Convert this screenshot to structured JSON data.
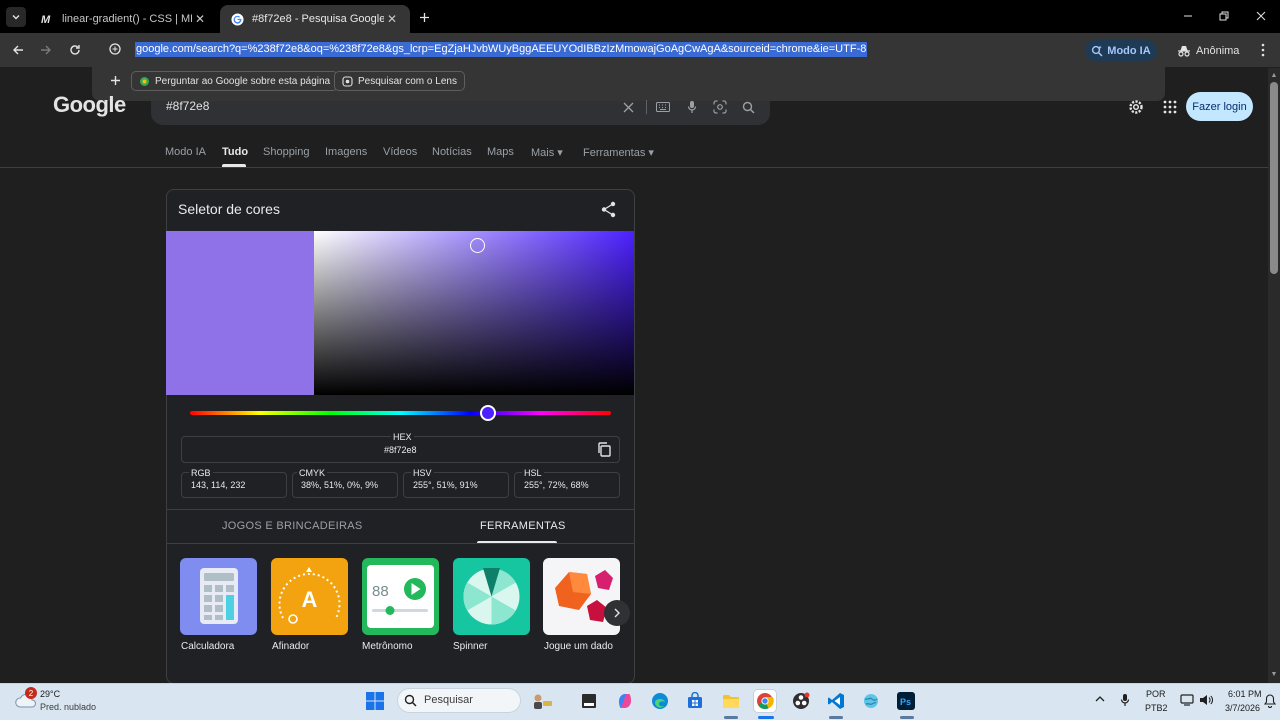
{
  "browser": {
    "tabs": [
      {
        "title": "linear-gradient() - CSS | MDN",
        "favicon": "mdn-m"
      },
      {
        "title": "#8f72e8 - Pesquisa Google",
        "favicon": "google-g",
        "active": true
      }
    ],
    "url": "google.com/search?q=%238f72e8&oq=%238f72e8&gs_lcrp=EgZjaHJvbWUyBggAEEUYOdIBBzIzMmowajGoAgCwAgA&sourceid=chrome&ie=UTF-8",
    "modo_ia_label": "Modo IA",
    "incognito_label": "Anônima",
    "dropdown_chips": [
      "Perguntar ao Google sobre esta página",
      "Pesquisar com o Lens"
    ]
  },
  "google": {
    "logo": "Google",
    "query": "#8f72e8",
    "login_label": "Fazer login",
    "nav": [
      {
        "label": "Modo IA"
      },
      {
        "label": "Tudo",
        "active": true
      },
      {
        "label": "Shopping"
      },
      {
        "label": "Imagens"
      },
      {
        "label": "Vídeos"
      },
      {
        "label": "Notícias"
      },
      {
        "label": "Maps"
      },
      {
        "label": "Mais"
      },
      {
        "label": "Ferramentas"
      }
    ]
  },
  "picker": {
    "title": "Seletor de cores",
    "selected_color": "#8f72e8",
    "hue_color": "#4c21ff",
    "hue_position": 0.708,
    "saturation": 0.51,
    "value": 0.91,
    "hex_label": "HEX",
    "hex_value": "#8f72e8",
    "fields": [
      {
        "label": "RGB",
        "value": "143, 114, 232"
      },
      {
        "label": "CMYK",
        "value": "38%, 51%, 0%, 9%"
      },
      {
        "label": "HSV",
        "value": "255°, 51%, 91%"
      },
      {
        "label": "HSL",
        "value": "255°, 72%, 68%"
      }
    ],
    "tabs": [
      {
        "label": "JOGOS E BRINCADEIRAS"
      },
      {
        "label": "FERRAMENTAS",
        "active": true
      }
    ],
    "tools": [
      {
        "label": "Calculadora",
        "icon": "calculator-icon"
      },
      {
        "label": "Afinador",
        "icon": "tuner-icon"
      },
      {
        "label": "Metrônomo",
        "icon": "metronome-icon",
        "display": "88"
      },
      {
        "label": "Spinner",
        "icon": "spinner-icon"
      },
      {
        "label": "Jogue um dado",
        "icon": "dice-icon"
      }
    ]
  },
  "taskbar": {
    "weather_temp": "29°C",
    "weather_desc": "Pred. nublado",
    "weather_badge": "2",
    "search_placeholder": "Pesquisar",
    "lang_top": "POR",
    "lang_bottom": "PTB2",
    "time": "6:01 PM",
    "date": "3/7/2026"
  },
  "colors": {
    "accent_blue": "#3a6ad4",
    "login_bg": "#c2e7ff",
    "modo_ia_bg": "#1e3a55"
  }
}
